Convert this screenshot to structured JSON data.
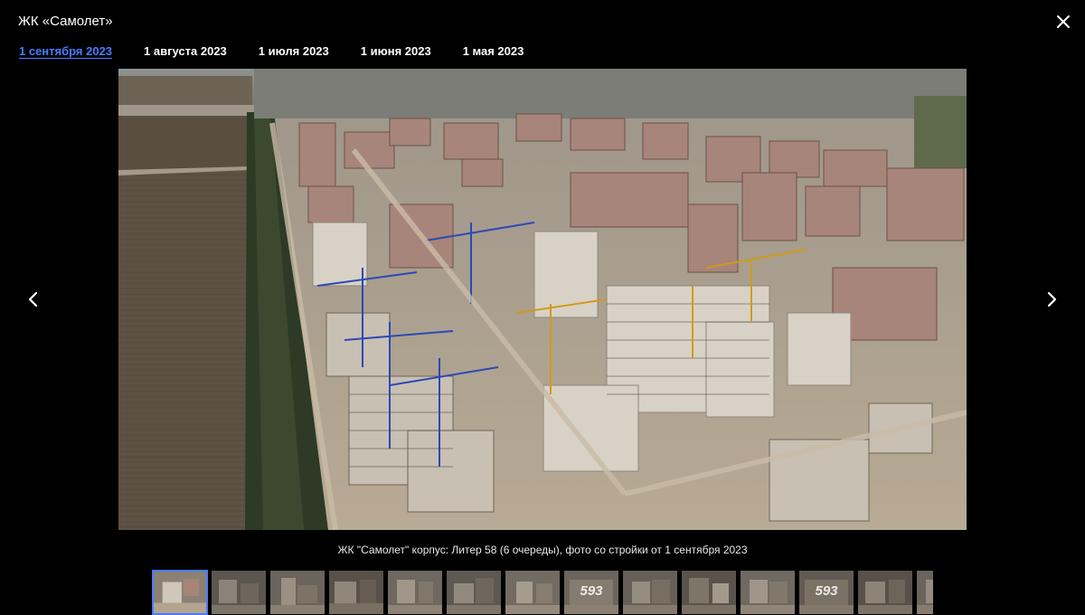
{
  "header": {
    "title": "ЖК «Самолет»"
  },
  "icons": {
    "close": "close-icon",
    "prev": "chevron-left-icon",
    "next": "chevron-right-icon"
  },
  "tabs": [
    {
      "label": "1 сентября 2023",
      "active": true
    },
    {
      "label": "1 августа 2023",
      "active": false
    },
    {
      "label": "1 июля 2023",
      "active": false
    },
    {
      "label": "1 июня 2023",
      "active": false
    },
    {
      "label": "1 мая 2023",
      "active": false
    }
  ],
  "caption": "ЖК \"Самолет\" корпус: Литер 58 (6 очереды), фото со стройки от 1 сентября 2023",
  "thumbnails": [
    {
      "label": ""
    },
    {
      "label": ""
    },
    {
      "label": ""
    },
    {
      "label": ""
    },
    {
      "label": ""
    },
    {
      "label": ""
    },
    {
      "label": ""
    },
    {
      "label": "593"
    },
    {
      "label": ""
    },
    {
      "label": ""
    },
    {
      "label": ""
    },
    {
      "label": "593"
    },
    {
      "label": ""
    },
    {
      "label": ""
    }
  ],
  "colors": {
    "accent": "#4a7cff",
    "background": "#000000"
  }
}
